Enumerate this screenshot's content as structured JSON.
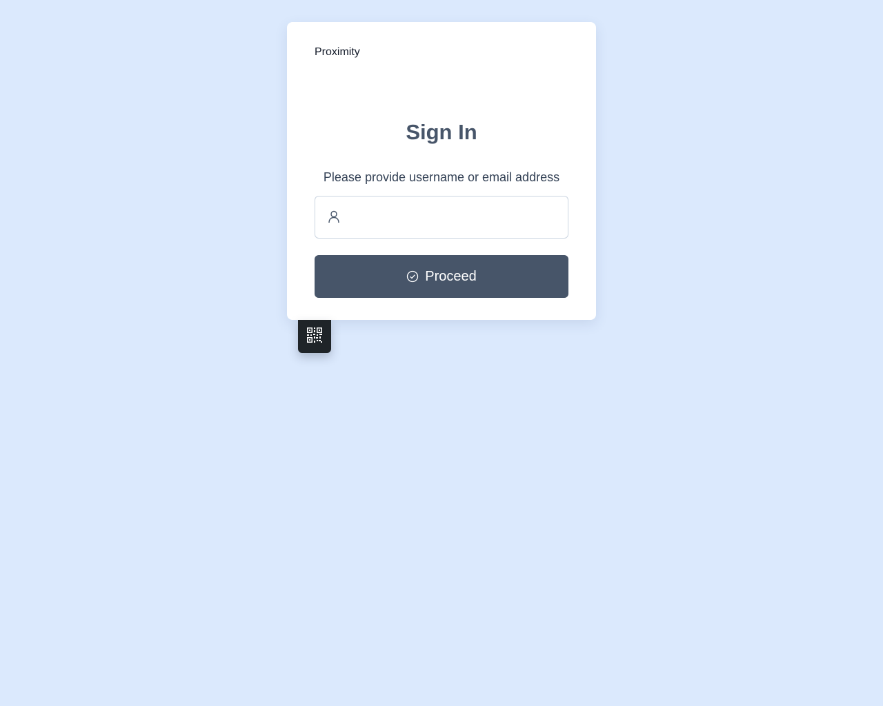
{
  "brand": "Proximity",
  "signin": {
    "title": "Sign In",
    "prompt": "Please provide username or email address",
    "input_value": "",
    "input_placeholder": "",
    "proceed_label": "Proceed"
  },
  "icons": {
    "input": "user-icon",
    "button": "check-circle-icon",
    "floating": "qr-code-icon"
  },
  "colors": {
    "background": "#dbe9fd",
    "card": "#ffffff",
    "primary_button": "#475569",
    "title_text": "#475569",
    "qr_button": "#1f2428"
  }
}
